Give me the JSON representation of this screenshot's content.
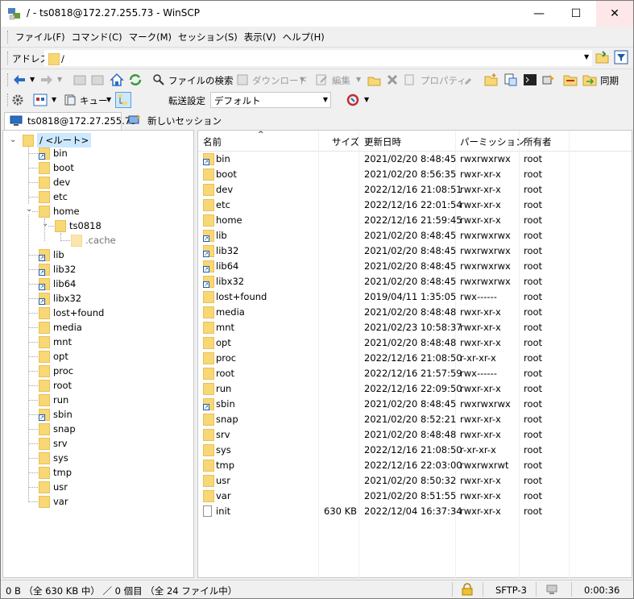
{
  "window": {
    "title": "/ - ts0818@172.27.255.73 - WinSCP",
    "minimize": "—",
    "maximize": "☐",
    "close": "✕"
  },
  "menu": [
    "ファイル(F)",
    "コマンド(C)",
    "マーク(M)",
    "セッション(S)",
    "表示(V)",
    "ヘルプ(H)"
  ],
  "address": {
    "label": "アドレス",
    "value": "/"
  },
  "toolbar1": {
    "find_files": "ファイルの検索",
    "download": "ダウンロード",
    "edit": "編集",
    "properties": "プロパティ",
    "sync": "同期"
  },
  "toolbar2": {
    "queue": "キュー",
    "transfer_label": "転送設定",
    "transfer_value": "デフォルト"
  },
  "tabs": {
    "session": "ts0818@172.27.255.73",
    "new_session": "新しいセッション"
  },
  "tree": {
    "root": "/ <ルート>",
    "items": [
      "bin",
      "boot",
      "dev",
      "etc",
      "home",
      "ts0818",
      ".cache",
      "lib",
      "lib32",
      "lib64",
      "libx32",
      "lost+found",
      "media",
      "mnt",
      "opt",
      "proc",
      "root",
      "run",
      "sbin",
      "snap",
      "srv",
      "sys",
      "tmp",
      "usr",
      "var"
    ]
  },
  "columns": {
    "name": "名前",
    "size": "サイズ",
    "modified": "更新日時",
    "perms": "パーミッション",
    "owner": "所有者"
  },
  "files": [
    {
      "name": "bin",
      "size": "",
      "modified": "2021/02/20 8:48:45",
      "perms": "rwxrwxrwx",
      "owner": "root",
      "kind": "link"
    },
    {
      "name": "boot",
      "size": "",
      "modified": "2021/02/20 8:56:35",
      "perms": "rwxr-xr-x",
      "owner": "root",
      "kind": "folder"
    },
    {
      "name": "dev",
      "size": "",
      "modified": "2022/12/16 21:08:51",
      "perms": "rwxr-xr-x",
      "owner": "root",
      "kind": "folder"
    },
    {
      "name": "etc",
      "size": "",
      "modified": "2022/12/16 22:01:54",
      "perms": "rwxr-xr-x",
      "owner": "root",
      "kind": "folder"
    },
    {
      "name": "home",
      "size": "",
      "modified": "2022/12/16 21:59:45",
      "perms": "rwxr-xr-x",
      "owner": "root",
      "kind": "folder"
    },
    {
      "name": "lib",
      "size": "",
      "modified": "2021/02/20 8:48:45",
      "perms": "rwxrwxrwx",
      "owner": "root",
      "kind": "link"
    },
    {
      "name": "lib32",
      "size": "",
      "modified": "2021/02/20 8:48:45",
      "perms": "rwxrwxrwx",
      "owner": "root",
      "kind": "link"
    },
    {
      "name": "lib64",
      "size": "",
      "modified": "2021/02/20 8:48:45",
      "perms": "rwxrwxrwx",
      "owner": "root",
      "kind": "link"
    },
    {
      "name": "libx32",
      "size": "",
      "modified": "2021/02/20 8:48:45",
      "perms": "rwxrwxrwx",
      "owner": "root",
      "kind": "link"
    },
    {
      "name": "lost+found",
      "size": "",
      "modified": "2019/04/11 1:35:05",
      "perms": "rwx------",
      "owner": "root",
      "kind": "folder"
    },
    {
      "name": "media",
      "size": "",
      "modified": "2021/02/20 8:48:48",
      "perms": "rwxr-xr-x",
      "owner": "root",
      "kind": "folder"
    },
    {
      "name": "mnt",
      "size": "",
      "modified": "2021/02/23 10:58:37",
      "perms": "rwxr-xr-x",
      "owner": "root",
      "kind": "folder"
    },
    {
      "name": "opt",
      "size": "",
      "modified": "2021/02/20 8:48:48",
      "perms": "rwxr-xr-x",
      "owner": "root",
      "kind": "folder"
    },
    {
      "name": "proc",
      "size": "",
      "modified": "2022/12/16 21:08:50",
      "perms": "r-xr-xr-x",
      "owner": "root",
      "kind": "folder"
    },
    {
      "name": "root",
      "size": "",
      "modified": "2022/12/16 21:57:59",
      "perms": "rwx------",
      "owner": "root",
      "kind": "folder"
    },
    {
      "name": "run",
      "size": "",
      "modified": "2022/12/16 22:09:50",
      "perms": "rwxr-xr-x",
      "owner": "root",
      "kind": "folder"
    },
    {
      "name": "sbin",
      "size": "",
      "modified": "2021/02/20 8:48:45",
      "perms": "rwxrwxrwx",
      "owner": "root",
      "kind": "link"
    },
    {
      "name": "snap",
      "size": "",
      "modified": "2021/02/20 8:52:21",
      "perms": "rwxr-xr-x",
      "owner": "root",
      "kind": "folder"
    },
    {
      "name": "srv",
      "size": "",
      "modified": "2021/02/20 8:48:48",
      "perms": "rwxr-xr-x",
      "owner": "root",
      "kind": "folder"
    },
    {
      "name": "sys",
      "size": "",
      "modified": "2022/12/16 21:08:50",
      "perms": "r-xr-xr-x",
      "owner": "root",
      "kind": "folder"
    },
    {
      "name": "tmp",
      "size": "",
      "modified": "2022/12/16 22:03:00",
      "perms": "rwxrwxrwt",
      "owner": "root",
      "kind": "folder"
    },
    {
      "name": "usr",
      "size": "",
      "modified": "2021/02/20 8:50:32",
      "perms": "rwxr-xr-x",
      "owner": "root",
      "kind": "folder"
    },
    {
      "name": "var",
      "size": "",
      "modified": "2021/02/20 8:51:55",
      "perms": "rwxr-xr-x",
      "owner": "root",
      "kind": "folder"
    },
    {
      "name": "init",
      "size": "630 KB",
      "modified": "2022/12/04 16:37:34",
      "perms": "rwxr-xr-x",
      "owner": "root",
      "kind": "file"
    }
  ],
  "status": {
    "selection": "0 B （全 630 KB 中） ／ 0 個目 （全 24 ファイル中）",
    "protocol": "SFTP-3",
    "elapsed": "0:00:36"
  }
}
